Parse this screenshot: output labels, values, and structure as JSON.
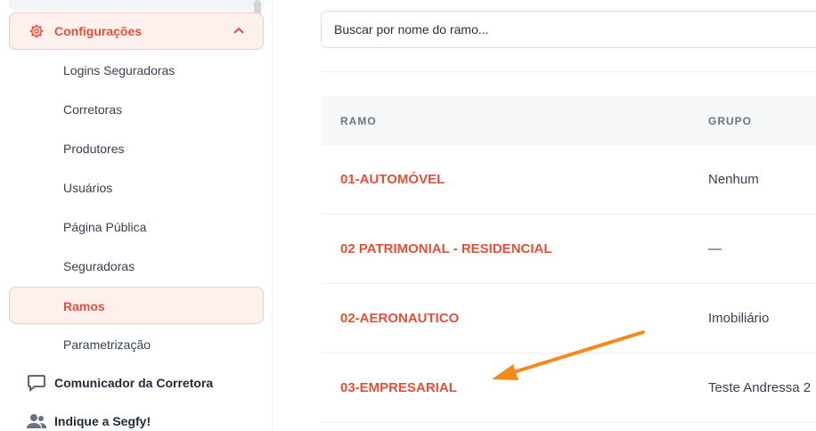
{
  "sidebar": {
    "config": {
      "label": "Configurações"
    },
    "submenu": [
      "Logins Seguradoras",
      "Corretoras",
      "Produtores",
      "Usuários",
      "Página Pública",
      "Seguradoras",
      "Ramos",
      "Parametrização"
    ],
    "active_index": 6,
    "links": [
      {
        "label": "Comunicador da Corretora",
        "icon": "chat-icon"
      },
      {
        "label": "Indique a Segfy!",
        "icon": "users-icon"
      }
    ]
  },
  "main": {
    "search": {
      "placeholder": "Buscar por nome do ramo..."
    },
    "table": {
      "headers": [
        "RAMO",
        "GRUPO"
      ],
      "rows": [
        {
          "ramo": "01-AUTOMÓVEL",
          "grupo": "Nenhum"
        },
        {
          "ramo": "02 PATRIMONIAL - RESIDENCIAL",
          "grupo": "—"
        },
        {
          "ramo": "02-AERONAUTICO",
          "grupo": "Imobiliário"
        },
        {
          "ramo": "03-EMPRESARIAL",
          "grupo": "Teste Andressa 2"
        }
      ]
    }
  },
  "colors": {
    "accent": "#e0513a",
    "accent_bg": "#fdf0ed",
    "arrow": "#f28a1c"
  }
}
